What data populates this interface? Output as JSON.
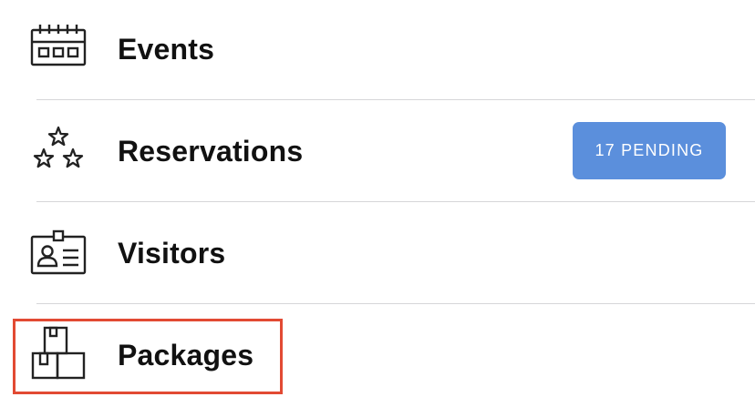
{
  "menu": {
    "items": [
      {
        "label": "Events",
        "icon": "calendar-icon"
      },
      {
        "label": "Reservations",
        "icon": "stars-icon",
        "badge": "17 PENDING"
      },
      {
        "label": "Visitors",
        "icon": "id-badge-icon"
      },
      {
        "label": "Packages",
        "icon": "boxes-icon"
      }
    ]
  },
  "colors": {
    "badge_bg": "#5b8fdc",
    "highlight": "#e24a33",
    "divider": "#d6d6d8",
    "text": "#111111"
  }
}
